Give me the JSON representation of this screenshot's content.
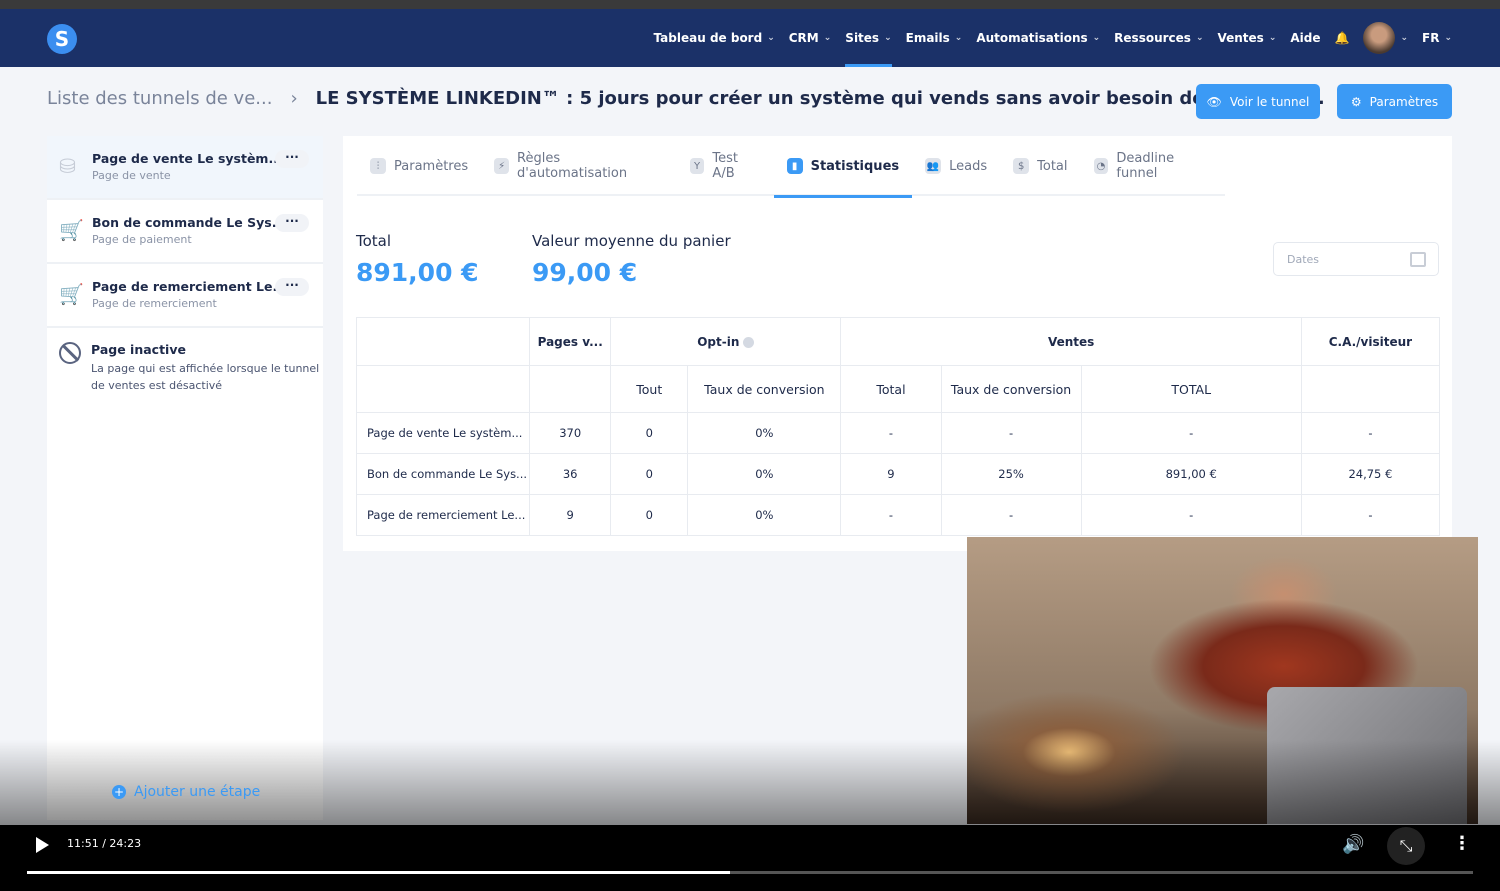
{
  "nav": {
    "logo": "S",
    "items": [
      {
        "label": "Tableau de bord"
      },
      {
        "label": "CRM"
      },
      {
        "label": "Sites",
        "active": true
      },
      {
        "label": "Emails"
      },
      {
        "label": "Automatisations"
      },
      {
        "label": "Ressources"
      },
      {
        "label": "Ventes"
      }
    ],
    "aide": "Aide",
    "lang": "FR"
  },
  "breadcrumb": {
    "parent": "Liste des tunnels de ve...",
    "title": "LE SYSTÈME LINKEDIN™ : 5 jours pour créer un système qui vends sans avoir besoin de 10k abon..."
  },
  "buttons": {
    "view": "Voir le tunnel",
    "settings": "Paramètres"
  },
  "sidebar": {
    "steps": [
      {
        "title": "Page de vente Le systèm...",
        "sub": "Page de vente",
        "icon": "coins-icon"
      },
      {
        "title": "Bon de commande Le Sys...",
        "sub": "Page de paiement",
        "icon": "cart-icon"
      },
      {
        "title": "Page de remerciement Le...",
        "sub": "Page de remerciement",
        "icon": "cart-check-icon"
      }
    ],
    "inactive_title": "Page inactive",
    "inactive_desc": "La page qui est affichée lorsque le tunnel de ventes est désactivé",
    "add": "Ajouter une étape"
  },
  "tabs": [
    {
      "label": "Paramètres",
      "icon": "⫶"
    },
    {
      "label": "Règles d'automatisation",
      "icon": "⚡"
    },
    {
      "label": "Test A/B",
      "icon": "Y"
    },
    {
      "label": "Statistiques",
      "icon": "▮",
      "active": true
    },
    {
      "label": "Leads",
      "icon": "👥"
    },
    {
      "label": "Total",
      "icon": "$"
    },
    {
      "label": "Deadline funnel",
      "icon": "◔"
    }
  ],
  "kpis": {
    "total_label": "Total",
    "total_value": "891,00 €",
    "avg_label": "Valeur moyenne du panier",
    "avg_value": "99,00 €"
  },
  "dates_placeholder": "Dates",
  "table": {
    "groups": [
      "Pages v...",
      "Opt-in",
      "Ventes",
      "C.A./visiteur"
    ],
    "sub": [
      "Tout",
      "Taux de conversion",
      "Total",
      "Taux de conversion",
      "TOTAL"
    ],
    "rows": [
      [
        "Page de vente Le systèm...",
        "370",
        "0",
        "0%",
        "-",
        "-",
        "-",
        "-"
      ],
      [
        "Bon de commande Le Sys...",
        "36",
        "0",
        "0%",
        "9",
        "25%",
        "891,00 €",
        "24,75 €"
      ],
      [
        "Page de remerciement Le...",
        "9",
        "0",
        "0%",
        "-",
        "-",
        "-",
        "-"
      ]
    ]
  },
  "player": {
    "time": "11:51 / 24:23",
    "progress": 0.486
  }
}
